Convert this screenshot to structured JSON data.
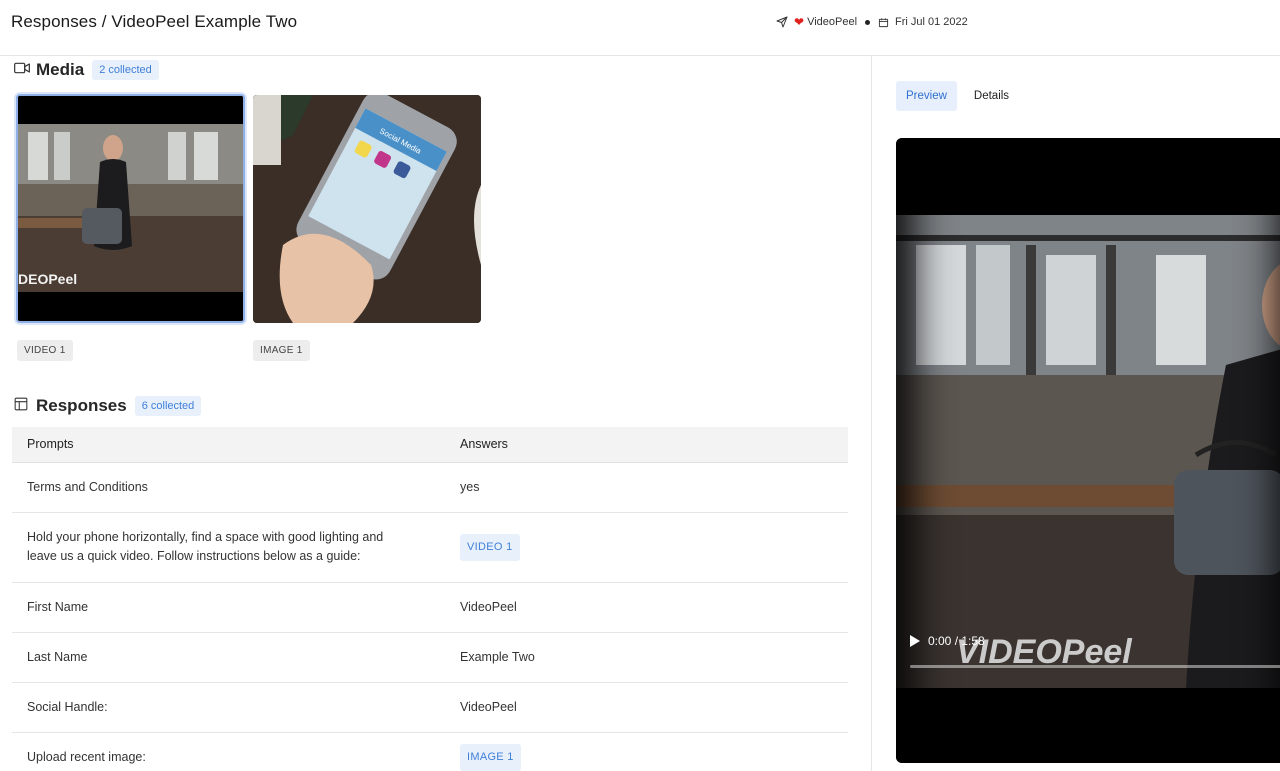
{
  "header": {
    "title": "Responses / VideoPeel Example Two",
    "source_name": "VideoPeel",
    "date": "Fri Jul 01 2022"
  },
  "media": {
    "title": "Media",
    "count_label": "2 collected",
    "items": [
      {
        "label": "VIDEO 1",
        "kind": "video",
        "watermark": "DEOPeel"
      },
      {
        "label": "IMAGE 1",
        "kind": "image",
        "screen_text": "Social Media"
      }
    ]
  },
  "responses": {
    "title": "Responses",
    "count_label": "6 collected",
    "columns": [
      "Prompts",
      "Answers"
    ],
    "rows": [
      {
        "prompt": "Terms and Conditions",
        "answer": "yes",
        "answer_type": "text"
      },
      {
        "prompt": "Hold your phone horizontally, find a space with good lighting and leave us a quick video. Follow instructions below as a guide:",
        "answer": "VIDEO 1",
        "answer_type": "tag"
      },
      {
        "prompt": "First Name",
        "answer": "VideoPeel",
        "answer_type": "text"
      },
      {
        "prompt": "Last Name",
        "answer": "Example Two",
        "answer_type": "text"
      },
      {
        "prompt": "Social Handle:",
        "answer": "VideoPeel",
        "answer_type": "text"
      },
      {
        "prompt": "Upload recent image:",
        "answer": "IMAGE 1",
        "answer_type": "tag"
      }
    ]
  },
  "preview": {
    "tabs": [
      {
        "label": "Preview",
        "active": true
      },
      {
        "label": "Details",
        "active": false
      }
    ],
    "player": {
      "time": "0:00 / 1:58",
      "progress": 0,
      "watermark": "VIDEOPeel"
    }
  },
  "colors": {
    "accent": "#3f7fd8",
    "accent_bg": "#e8f0fc",
    "heart": "#e0211e"
  }
}
